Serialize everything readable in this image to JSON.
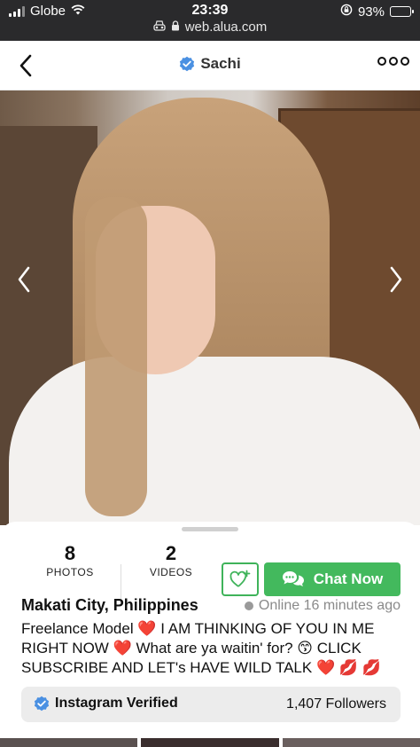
{
  "status_bar": {
    "carrier": "Globe",
    "time": "23:39",
    "url": "web.alua.com",
    "battery": "93%",
    "battery_level": 0.93
  },
  "nav": {
    "title": "Sachi",
    "back_icon": "chevron-left-icon",
    "more_icon": "more-dots-icon"
  },
  "stats": {
    "photos_count": "8",
    "photos_label": "PHOTOS",
    "videos_count": "2",
    "videos_label": "VIDEOS"
  },
  "actions": {
    "chat_label": "Chat Now"
  },
  "profile": {
    "location": "Makati City, Philippines",
    "online": "Online 16 minutes ago",
    "bio": "Freelance Model ❤️ I AM THINKING OF YOU IN ME RIGHT NOW ❤️ What are ya waitin' for? 😙 CLICK SUBSCRIBE AND LET's HAVE WILD TALK ❤️ 💋 💋"
  },
  "instagram": {
    "label": "Instagram Verified",
    "followers": "1,407 Followers"
  },
  "colors": {
    "accent_green": "#43b95d",
    "verified_blue": "#4a90e2",
    "status_bar_bg": "#2a2a2c"
  }
}
